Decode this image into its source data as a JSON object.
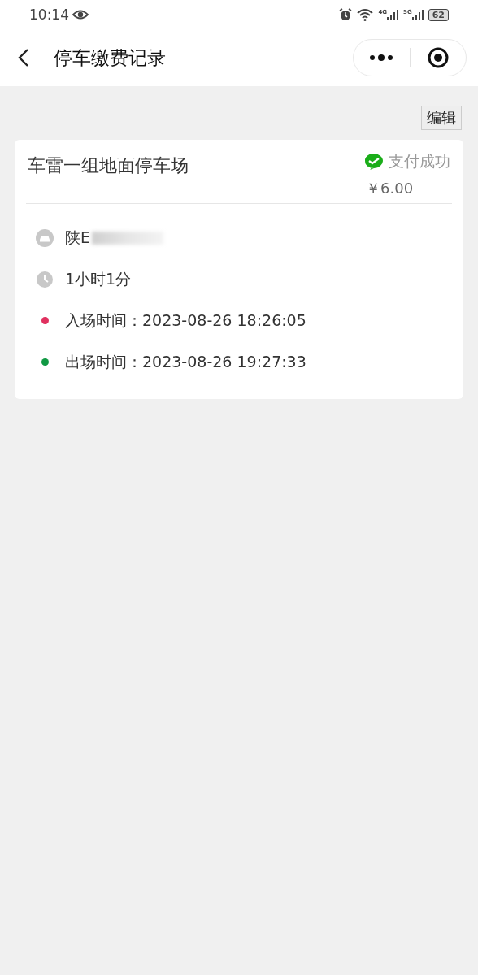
{
  "status_bar": {
    "time": "10:14",
    "network_labels": [
      "4G",
      "5G"
    ],
    "battery": "62"
  },
  "nav": {
    "title": "停车缴费记录"
  },
  "edit_button": "编辑",
  "records": [
    {
      "lot": "车雷一组地面停车场",
      "status": "支付成功",
      "amount": "￥6.00",
      "details": [
        {
          "kind": "car",
          "text": "陕E"
        },
        {
          "kind": "clock",
          "text": "1小时1分"
        },
        {
          "kind": "dot",
          "color": "#e0305f",
          "text": "入场时间：2023-08-26 18:26:05"
        },
        {
          "kind": "dot",
          "color": "#119944",
          "text": "出场时间：2023-08-26 19:27:33"
        }
      ]
    }
  ]
}
